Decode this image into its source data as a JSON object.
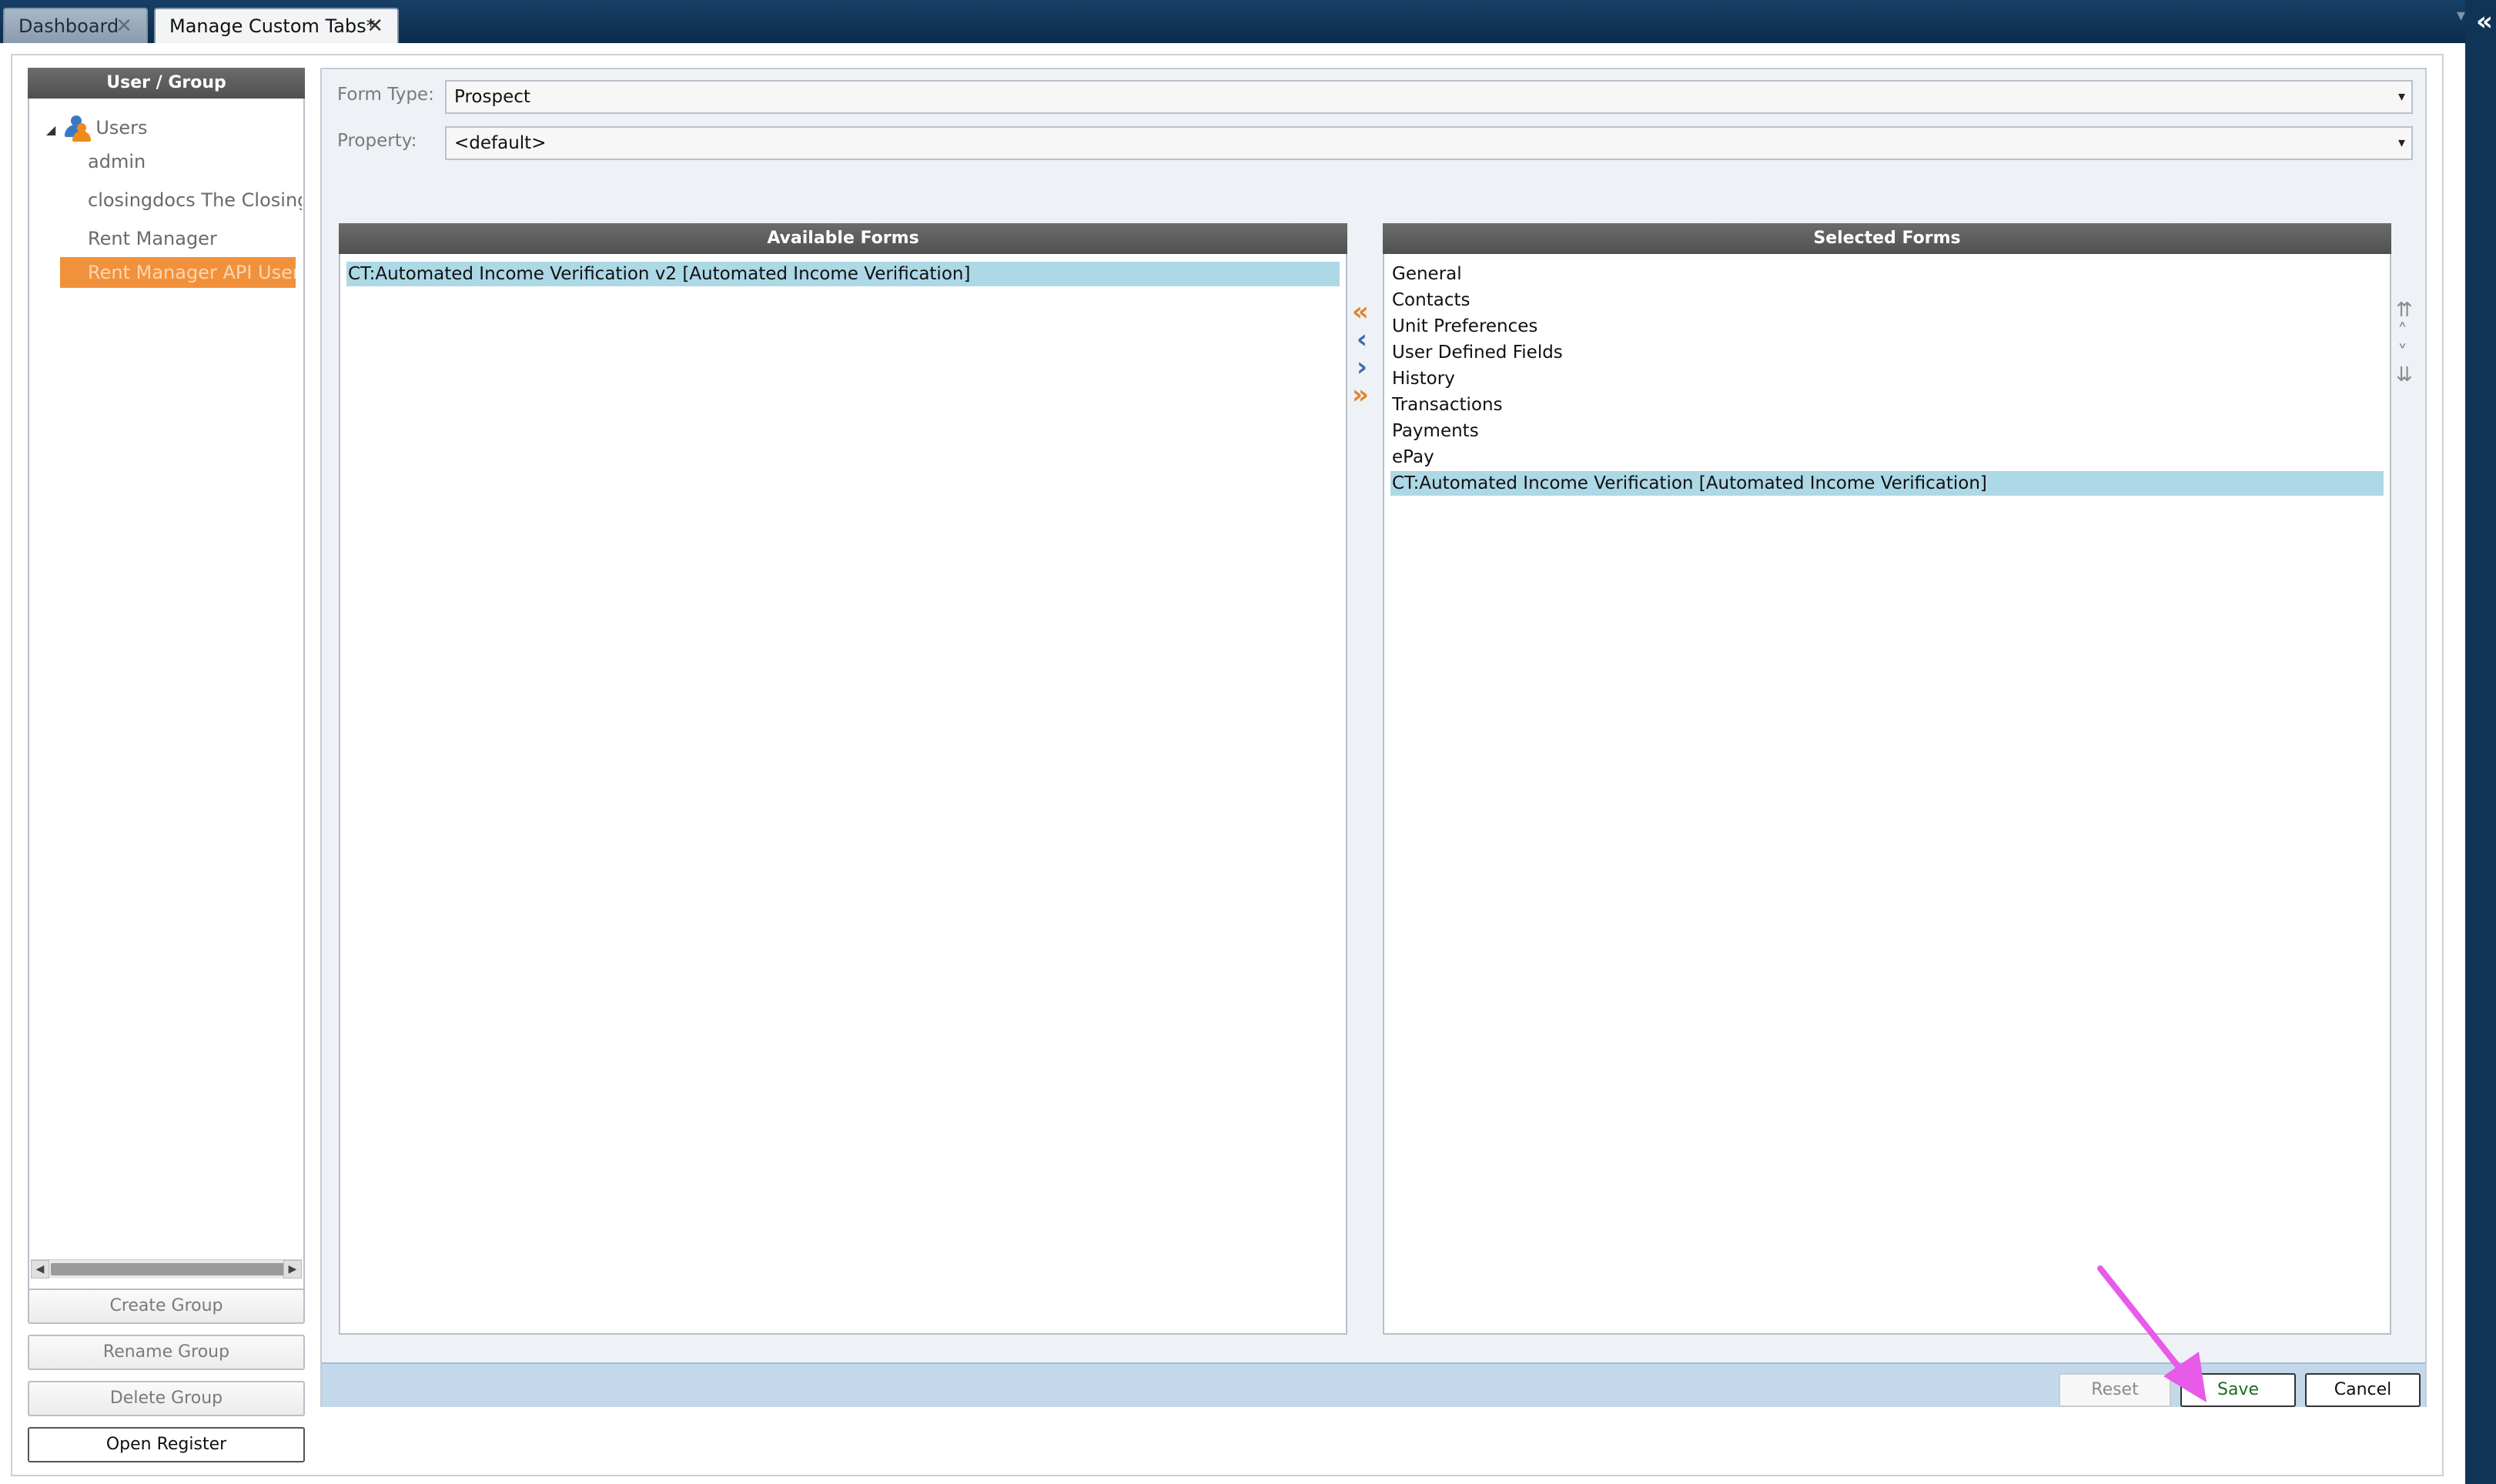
{
  "tabs": [
    {
      "label": "Dashboard",
      "close": "✕"
    },
    {
      "label": "Manage Custom Tabs*",
      "close": "✕"
    }
  ],
  "left_panel": {
    "header": "User / Group",
    "tree_root": "Users",
    "items": [
      "admin",
      "closingdocs The Closing D",
      "Rent Manager",
      "Rent Manager API User"
    ],
    "selected_item": "Rent Manager API User",
    "buttons": {
      "create_group": "Create Group",
      "rename_group": "Rename Group",
      "delete_group": "Delete Group",
      "open_register": "Open Register"
    }
  },
  "form": {
    "form_type_label": "Form Type:",
    "form_type_value": "Prospect",
    "property_label": "Property:",
    "property_value": "<default>"
  },
  "available_forms": {
    "header": "Available Forms",
    "items": [
      "CT:Automated Income Verification v2 [Automated Income Verification]"
    ],
    "selected_item": "CT:Automated Income Verification v2 [Automated Income Verification]"
  },
  "selected_forms": {
    "header": "Selected Forms",
    "items": [
      "General",
      "Contacts",
      "Unit Preferences",
      "User Defined Fields",
      "History",
      "Transactions",
      "Payments",
      "ePay",
      "CT:Automated Income Verification [Automated Income Verification]"
    ],
    "selected_item": "CT:Automated Income Verification [Automated Income Verification]"
  },
  "icons": {
    "move_all_left": "«",
    "move_left": "‹",
    "move_right": "›",
    "move_all_right": "»",
    "move_top": "⇈",
    "move_up": "˄",
    "move_down": "˅",
    "move_bottom": "⇊",
    "dropdown": "▾",
    "tree_caret": "◢"
  },
  "footer_buttons": {
    "reset": "Reset",
    "save": "Save",
    "cancel": "Cancel"
  },
  "colors": {
    "titlebar": "#0f3456",
    "selected_user": "#f2913c",
    "highlight_row": "#add8e6",
    "annotation_arrow": "#e85be8",
    "save_text": "#1d6a1d"
  }
}
